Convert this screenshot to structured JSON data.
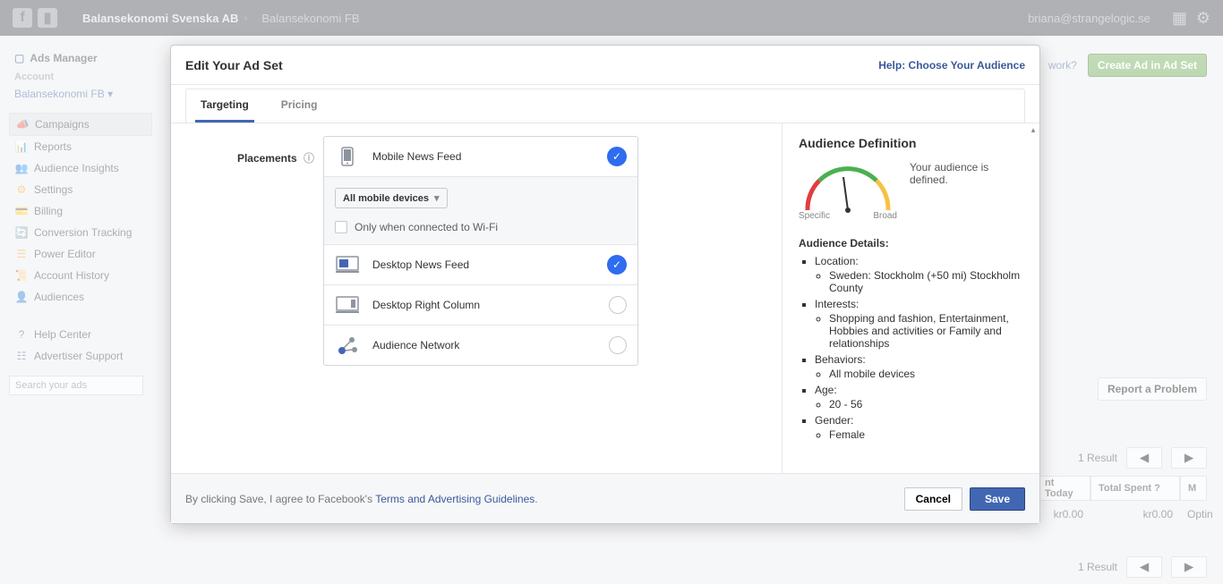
{
  "topbar": {
    "org": "Balansekonomi Svenska AB",
    "sub": "Balansekonomi FB",
    "email": "briana@strangelogic.se"
  },
  "sidebar": {
    "title": "Ads Manager",
    "section_account": "Account",
    "account_name": "Balansekonomi FB",
    "items": [
      {
        "label": "Campaigns",
        "icon": "📣",
        "active": true
      },
      {
        "label": "Reports",
        "icon": "📊"
      },
      {
        "label": "Audience Insights",
        "icon": "👥"
      },
      {
        "label": "Settings",
        "icon": "⚙"
      },
      {
        "label": "Billing",
        "icon": "💳"
      },
      {
        "label": "Conversion Tracking",
        "icon": "🔄"
      },
      {
        "label": "Power Editor",
        "icon": "☰"
      },
      {
        "label": "Account History",
        "icon": "📜"
      },
      {
        "label": "Audiences",
        "icon": "👤"
      }
    ],
    "help": [
      {
        "label": "Help Center",
        "icon": "?"
      },
      {
        "label": "Advertiser Support",
        "icon": "☷"
      }
    ],
    "search_placeholder": "Search your ads"
  },
  "bg": {
    "help_link": "work?",
    "create_btn": "Create Ad in Ad Set",
    "result_label": "1 Result",
    "headers": {
      "today": "nt Today",
      "spent": "Total Spent ?",
      "m": "M"
    },
    "row": {
      "today": "kr0.00",
      "spent": "kr0.00",
      "opt": "Optin"
    },
    "report": "Report a Problem"
  },
  "modal": {
    "title": "Edit Your Ad Set",
    "help": "Help: Choose Your Audience",
    "tabs": {
      "targeting": "Targeting",
      "pricing": "Pricing"
    },
    "placements_label": "Placements",
    "placements": [
      {
        "label": "Mobile News Feed",
        "sel": true,
        "icon": "mobile"
      },
      {
        "label": "Desktop News Feed",
        "sel": true,
        "icon": "desktop"
      },
      {
        "label": "Desktop Right Column",
        "sel": false,
        "icon": "desktop"
      },
      {
        "label": "Audience Network",
        "sel": false,
        "icon": "network"
      }
    ],
    "device_sel": "All mobile devices",
    "wifi": "Only when connected to Wi-Fi",
    "aud": {
      "title": "Audience Definition",
      "msg": "Your audience is defined.",
      "specific": "Specific",
      "broad": "Broad",
      "details_head": "Audience Details:",
      "location": "Location:",
      "location_val": "Sweden: Stockholm (+50 mi) Stockholm County",
      "interests": "Interests:",
      "interests_val": "Shopping and fashion, Entertainment, Hobbies and activities or Family and relationships",
      "behaviors": "Behaviors:",
      "behaviors_val": "All mobile devices",
      "age": "Age:",
      "age_val": "20 - 56",
      "gender": "Gender:",
      "gender_val": "Female"
    },
    "terms_pre": "By clicking Save, I agree to Facebook's ",
    "terms_link": "Terms and Advertising Guidelines",
    "cancel": "Cancel",
    "save": "Save"
  }
}
